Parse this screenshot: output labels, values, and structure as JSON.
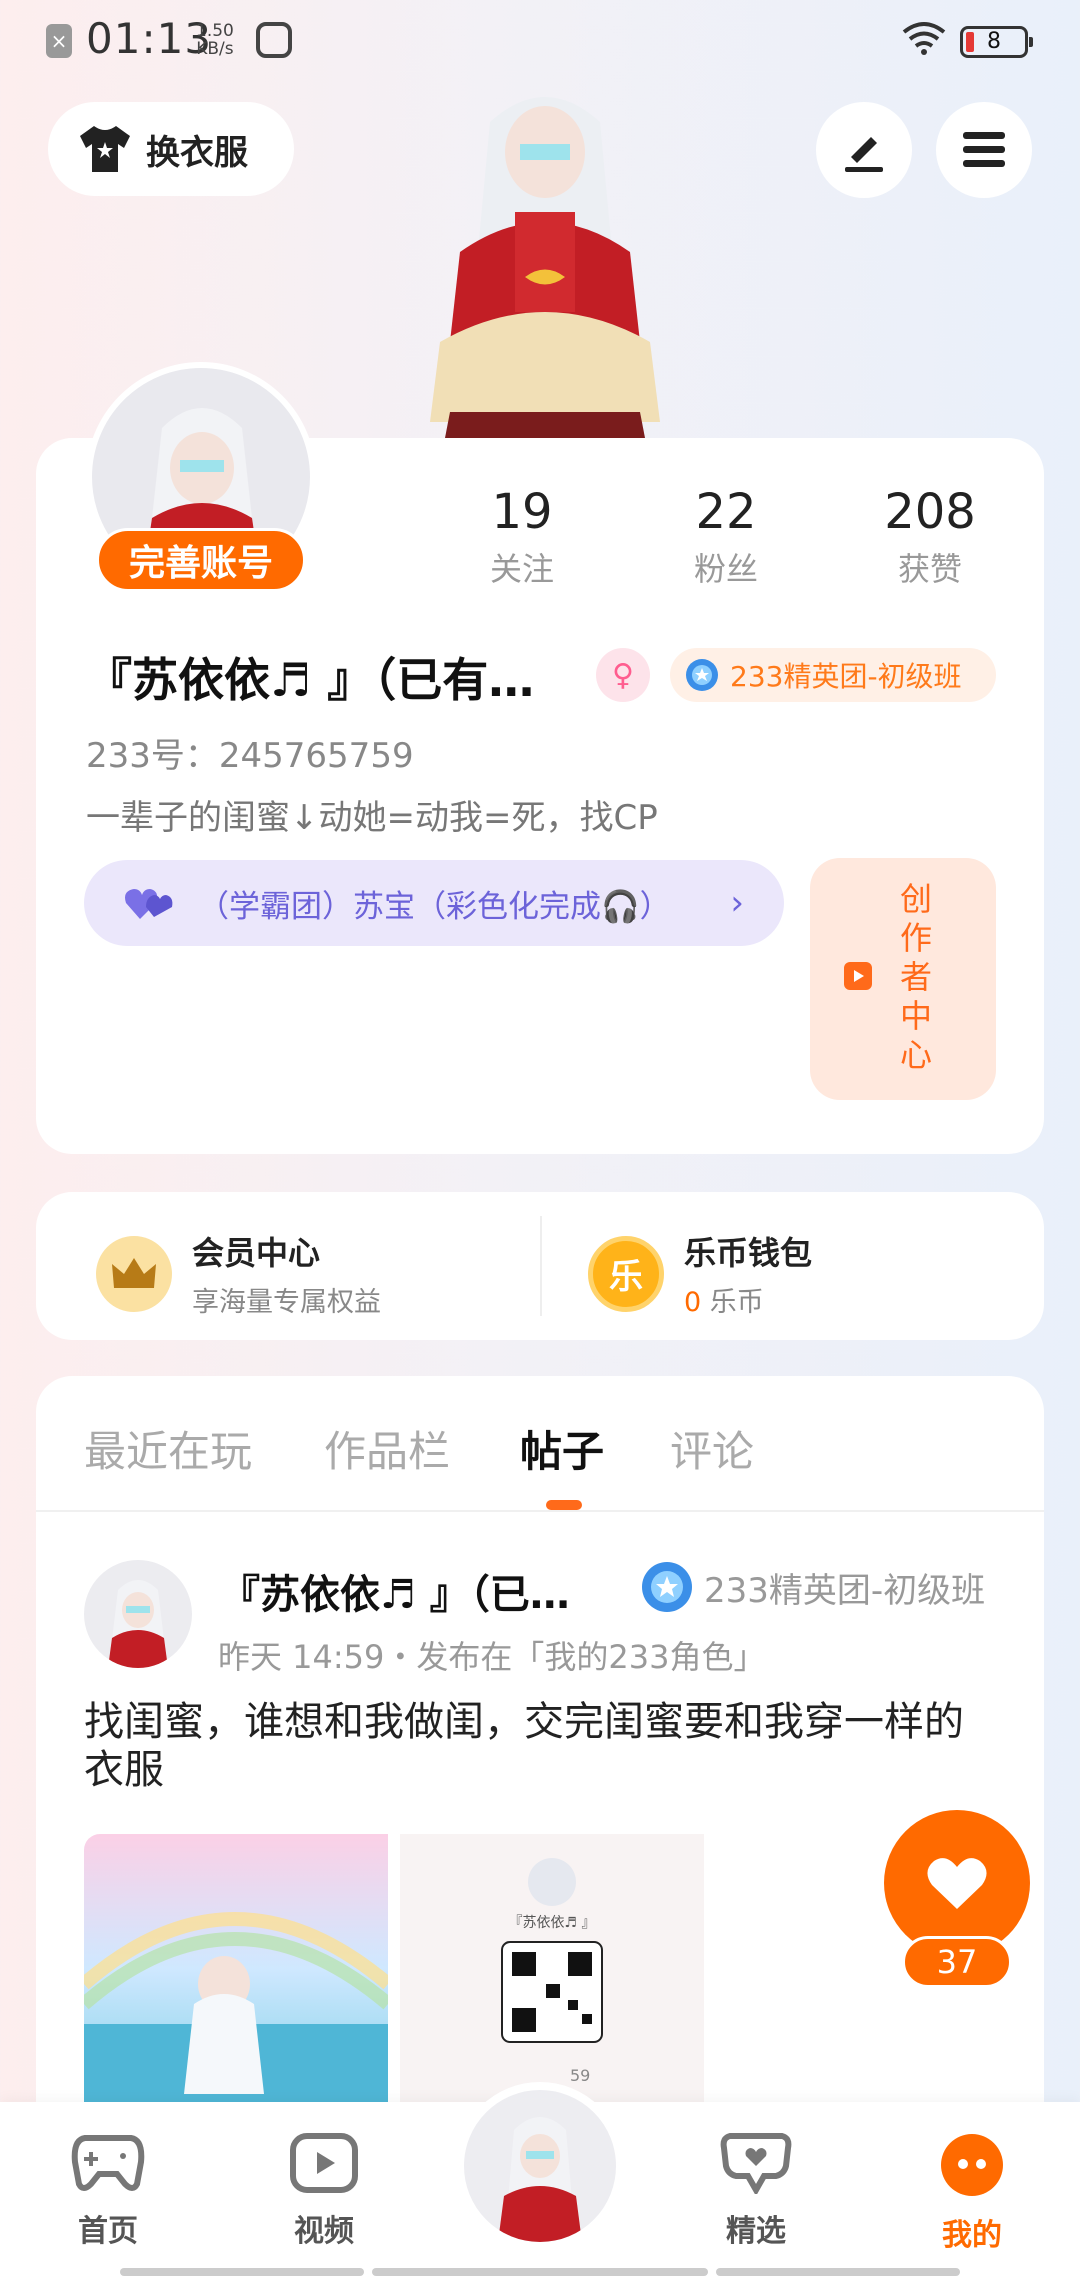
{
  "status_bar": {
    "time": "01:13",
    "net_speed_value": "1.50",
    "net_speed_unit": "KB/s",
    "battery": "8"
  },
  "header": {
    "dress_up_label": "换衣服"
  },
  "profile": {
    "complete_account_label": "完善账号",
    "stats": [
      {
        "value": "19",
        "label": "关注"
      },
      {
        "value": "22",
        "label": "粉丝"
      },
      {
        "value": "208",
        "label": "获赞"
      }
    ],
    "nickname": "『苏依依♬ 』（已有…",
    "class_badge": "233精英团-初级班",
    "uid": "233号：245765759",
    "bio": "一辈子的闺蜜↓动她=动我=死，找CP",
    "group_pill": "（学霸团）苏宝（彩色化完成🎧）",
    "creator_center": [
      "创",
      "作",
      "者",
      "中",
      "心"
    ]
  },
  "services": {
    "member": {
      "title": "会员中心",
      "subtitle": "享海量专属权益"
    },
    "wallet": {
      "title": "乐币钱包",
      "amount": "0",
      "unit": " 乐币",
      "coin_char": "乐"
    }
  },
  "tabs": [
    {
      "label": "最近在玩",
      "active": false
    },
    {
      "label": "作品栏",
      "active": false
    },
    {
      "label": "帖子",
      "active": true
    },
    {
      "label": "评论",
      "active": false
    }
  ],
  "post": {
    "author": "『苏依依♬ 』（已…",
    "badge": "233精英团-初级班",
    "meta": "昨天 14:59・发布在「我的233角色」",
    "text": "找闺蜜，谁想和我做闺，交完闺蜜要和我穿一样的衣服",
    "img2_caption": "『苏依依♬ 』",
    "img2_footer": "59",
    "like_count": "37"
  },
  "bottom_nav": [
    {
      "label": "首页",
      "icon": "gamepad-icon"
    },
    {
      "label": "视频",
      "icon": "video-play-icon"
    },
    {
      "label": "精选",
      "icon": "heart-chat-icon"
    },
    {
      "label": "我的",
      "icon": "profile-face-icon"
    }
  ],
  "colors": {
    "accent": "#ff6a00",
    "group_purple": "#6c63d9",
    "group_bg": "#ebe7fb"
  }
}
